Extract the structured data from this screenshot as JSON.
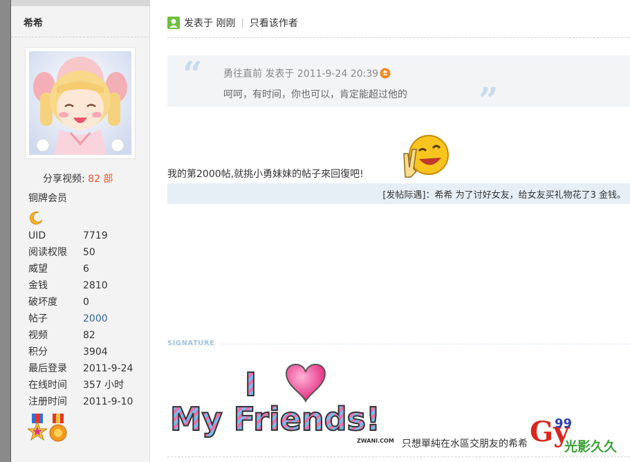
{
  "sidebar": {
    "username": "希希",
    "share_label": "分享视频:",
    "share_count": "82 部",
    "rank": "铜牌会员",
    "stats": [
      {
        "key": "UID",
        "value": "7719"
      },
      {
        "key": "阅读权限",
        "value": "50"
      },
      {
        "key": "威望",
        "value": "6"
      },
      {
        "key": "金钱",
        "value": "2810"
      },
      {
        "key": "破坏度",
        "value": "0"
      },
      {
        "key": "帖子",
        "value": "2000"
      },
      {
        "key": "视频",
        "value": "82"
      },
      {
        "key": "积分",
        "value": "3904"
      },
      {
        "key": "最后登录",
        "value": "2011-9-24"
      },
      {
        "key": "在线时间",
        "value": "357 小时"
      },
      {
        "key": "注册时间",
        "value": "2011-9-10"
      }
    ]
  },
  "post": {
    "posted": "发表于 刚刚",
    "separator": "|",
    "only_author": "只看该作者",
    "quote": {
      "meta": "勇往直前 发表于 2011-9-24 20:39",
      "text": "呵呵，有时间，你也可以，肯定能超过他的",
      "open_mark": "“",
      "close_mark": "”"
    },
    "body": "我的第2000帖,就挑小勇妹妹的帖子來回復吧!",
    "reward": "[发帖际遇]：希希 为了讨好女友，给女友买礼物花了3 金钱。",
    "signature_label": "SIGNATURE",
    "signature_image_text": {
      "line1": "I",
      "line2": "My Friends!",
      "credit": "ZWANI.COM"
    },
    "signature_text": "只想單純在水區交朋友的希希",
    "watermark": {
      "letters": "Gy",
      "num": "99",
      "text": "光影久久"
    }
  },
  "colors": {
    "accent_orange": "#e0542c",
    "link_blue": "#336699",
    "quote_bg": "#f2f4f6",
    "reward_bg": "#e6eef6",
    "sidebar_bg": "#f3f3f3"
  }
}
